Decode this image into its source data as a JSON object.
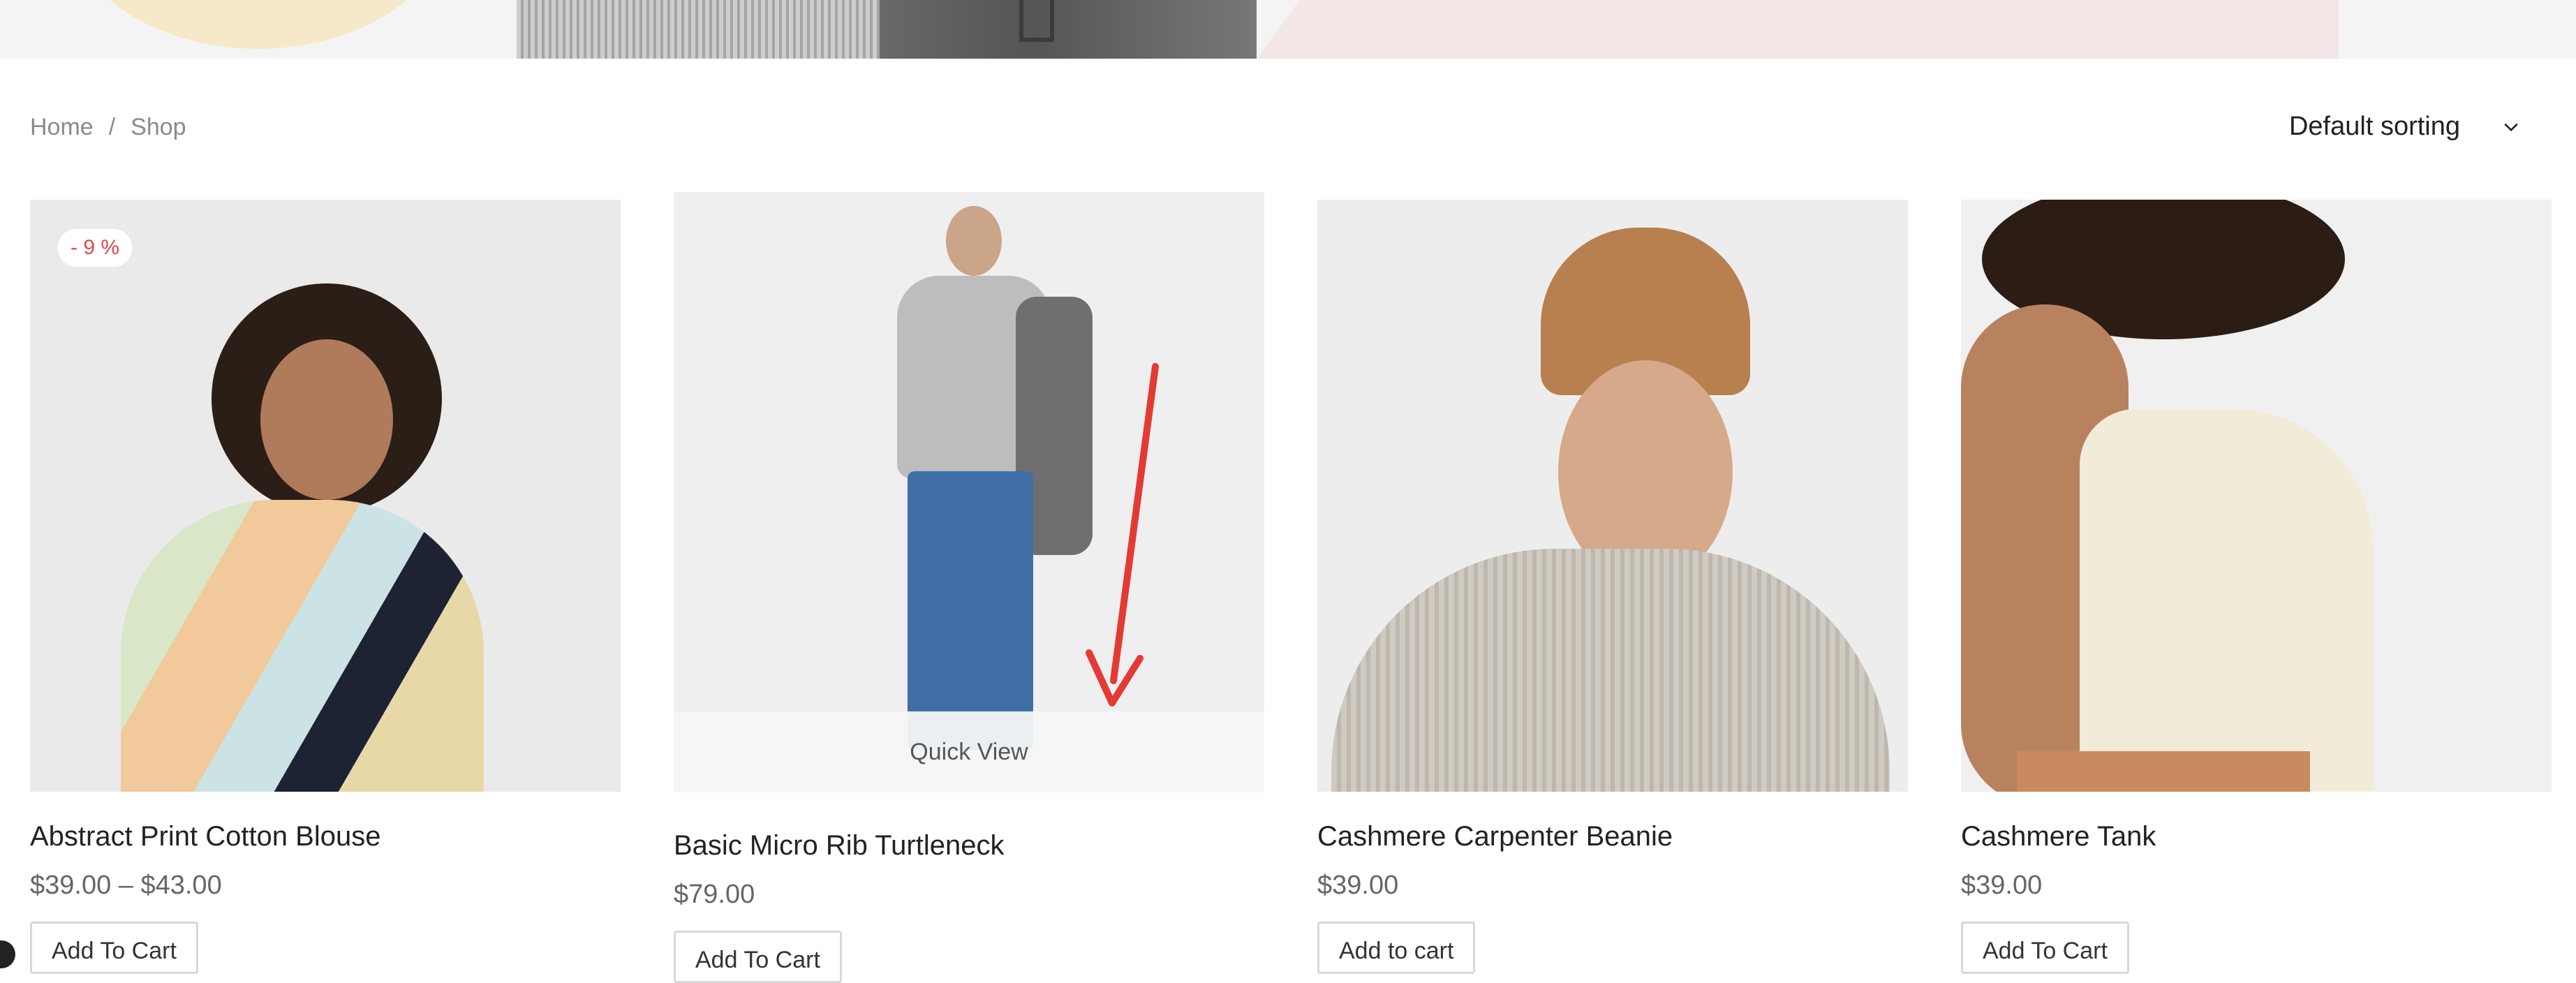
{
  "breadcrumb": {
    "home": "Home",
    "separator": "/",
    "current": "Shop"
  },
  "sorting": {
    "selected": "Default sorting"
  },
  "products": [
    {
      "title": "Abstract Print Cotton Blouse",
      "price": "$39.00 – $43.00",
      "badge": "- 9 %",
      "cart_label": "Add To Cart"
    },
    {
      "title": "Basic Micro Rib Turtleneck",
      "price": "$79.00",
      "quick_view": "Quick View",
      "cart_label": "Add To Cart"
    },
    {
      "title": "Cashmere Carpenter Beanie",
      "price": "$39.00",
      "cart_label": "Add to cart"
    },
    {
      "title": "Cashmere Tank",
      "price": "$39.00",
      "cart_label": "Add To Cart"
    }
  ],
  "colors": {
    "sale_red": "#e04848",
    "annotation_arrow": "#e53935"
  }
}
